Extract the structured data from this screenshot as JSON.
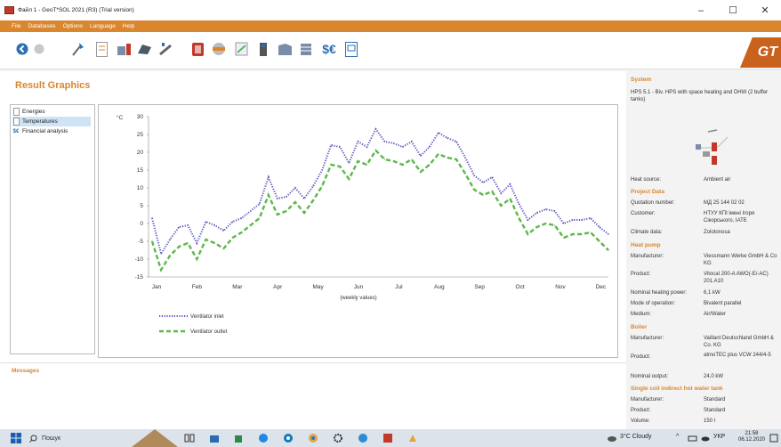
{
  "window": {
    "title": "Файл 1 - GeoT*SOL 2021 (R3) (Trial version)",
    "minimize": "–",
    "maximize": "☐",
    "close": "✕"
  },
  "menu": [
    "File",
    "Databases",
    "Options",
    "Language",
    "Help"
  ],
  "toolbar": {
    "currency_label": "$€",
    "logo_text": "GT"
  },
  "page": {
    "title": "Result Graphics"
  },
  "nav": [
    {
      "label": "Energies",
      "icon": "document-icon"
    },
    {
      "label": "Temperatures",
      "icon": "document-icon"
    },
    {
      "label": "Financial analysis",
      "icon": "currency-icon"
    }
  ],
  "nav_currency_glyph": "$€",
  "chart_data": {
    "type": "line",
    "ylabel": "°C",
    "xlabel": "(weekly values)",
    "ylim": [
      -15,
      30
    ],
    "yticks": [
      30,
      25,
      20,
      15,
      10,
      5,
      0,
      -5,
      -10,
      -15
    ],
    "x_months": [
      "Jan",
      "Feb",
      "Mar",
      "Apr",
      "May",
      "Jun",
      "Jul",
      "Aug",
      "Sep",
      "Oct",
      "Nov",
      "Dec"
    ],
    "weeks": 52,
    "series": [
      {
        "name": "Ventilator inlet",
        "color": "#5b54b8",
        "style": "dotted",
        "values": [
          1.5,
          -8.5,
          -4.5,
          -1,
          -0.5,
          -5.5,
          0.5,
          -0.5,
          -2,
          0.5,
          1.5,
          3.5,
          5.5,
          13,
          7,
          7.5,
          10,
          7,
          10.5,
          15,
          22,
          21.5,
          17,
          23,
          21.5,
          26.5,
          23,
          22.5,
          21.5,
          23,
          19,
          21.5,
          25.5,
          24,
          23,
          18.5,
          13.5,
          11.5,
          13,
          8.5,
          11,
          5.5,
          1,
          3,
          4,
          3.5,
          0,
          1,
          1,
          1.5,
          -1,
          -3
        ]
      },
      {
        "name": "Ventilator outlet",
        "color": "#5bb84a",
        "style": "dashed",
        "values": [
          -5,
          -13,
          -9,
          -6.5,
          -5.5,
          -10,
          -4.5,
          -5.5,
          -7,
          -4,
          -2.5,
          -0.5,
          1.5,
          8,
          2.5,
          3.5,
          6,
          3,
          6.5,
          10.5,
          16.5,
          16,
          12.5,
          17.5,
          16.5,
          20.5,
          18,
          17.5,
          16.5,
          18,
          14.5,
          16.5,
          19.5,
          18.5,
          18,
          14,
          9.5,
          8,
          9,
          5,
          7,
          1.5,
          -3,
          -1,
          0,
          -0.5,
          -4,
          -3,
          -3,
          -2.5,
          -5,
          -7.5
        ]
      }
    ]
  },
  "messages": {
    "title": "Messages"
  },
  "sidebar": {
    "system": {
      "title": "System",
      "description": "HPS 5.1 - Biv. HPS with space heating and DHW (2 buffer tanks)",
      "heat_source_label": "Heat source:",
      "heat_source_value": "Ambient air"
    },
    "project": {
      "title": "Project Data",
      "rows": [
        {
          "label": "Quotation number:",
          "value": "МД 25 144 02 02"
        },
        {
          "label": "Customer:",
          "value": "НТУУ КПІ імені Ігоря Сікорського, ІАТЕ"
        },
        {
          "label": "Climate data:",
          "value": "Zolotonosa"
        }
      ]
    },
    "heatpump": {
      "title": "Heat pump",
      "rows": [
        {
          "label": "Manufacturer:",
          "value": "Viessmann Werke GmbH & Co KG"
        },
        {
          "label": "Product:",
          "value": "Vitocal 200-A AWO(-E/-AC) 201.A10"
        },
        {
          "label": "Nominal heating power:",
          "value": "6,1 kW"
        },
        {
          "label": "Mode of operation:",
          "value": "Bivalent parallel"
        },
        {
          "label": "Medium:",
          "value": "Air/Water"
        }
      ]
    },
    "boiler": {
      "title": "Boiler",
      "rows": [
        {
          "label": "Manufacturer:",
          "value": "Vaillant Deutschland GmbH & Co. KG"
        },
        {
          "label": "Product:",
          "value": "atmoTEC plus VCW 244/4-5"
        },
        {
          "label": "Nominal output:",
          "value": "24,0 kW"
        }
      ]
    },
    "tank": {
      "title": "Single coil indirect hot water tank",
      "rows": [
        {
          "label": "Manufacturer:",
          "value": "Standard"
        },
        {
          "label": "Product:",
          "value": "Standard"
        },
        {
          "label": "Volume:",
          "value": "150 l"
        }
      ]
    }
  },
  "taskbar": {
    "search_placeholder": "Пошук",
    "weather": "3°C  Cloudy",
    "language": "УКР",
    "time": "21:58",
    "date": "06.12.2020"
  }
}
